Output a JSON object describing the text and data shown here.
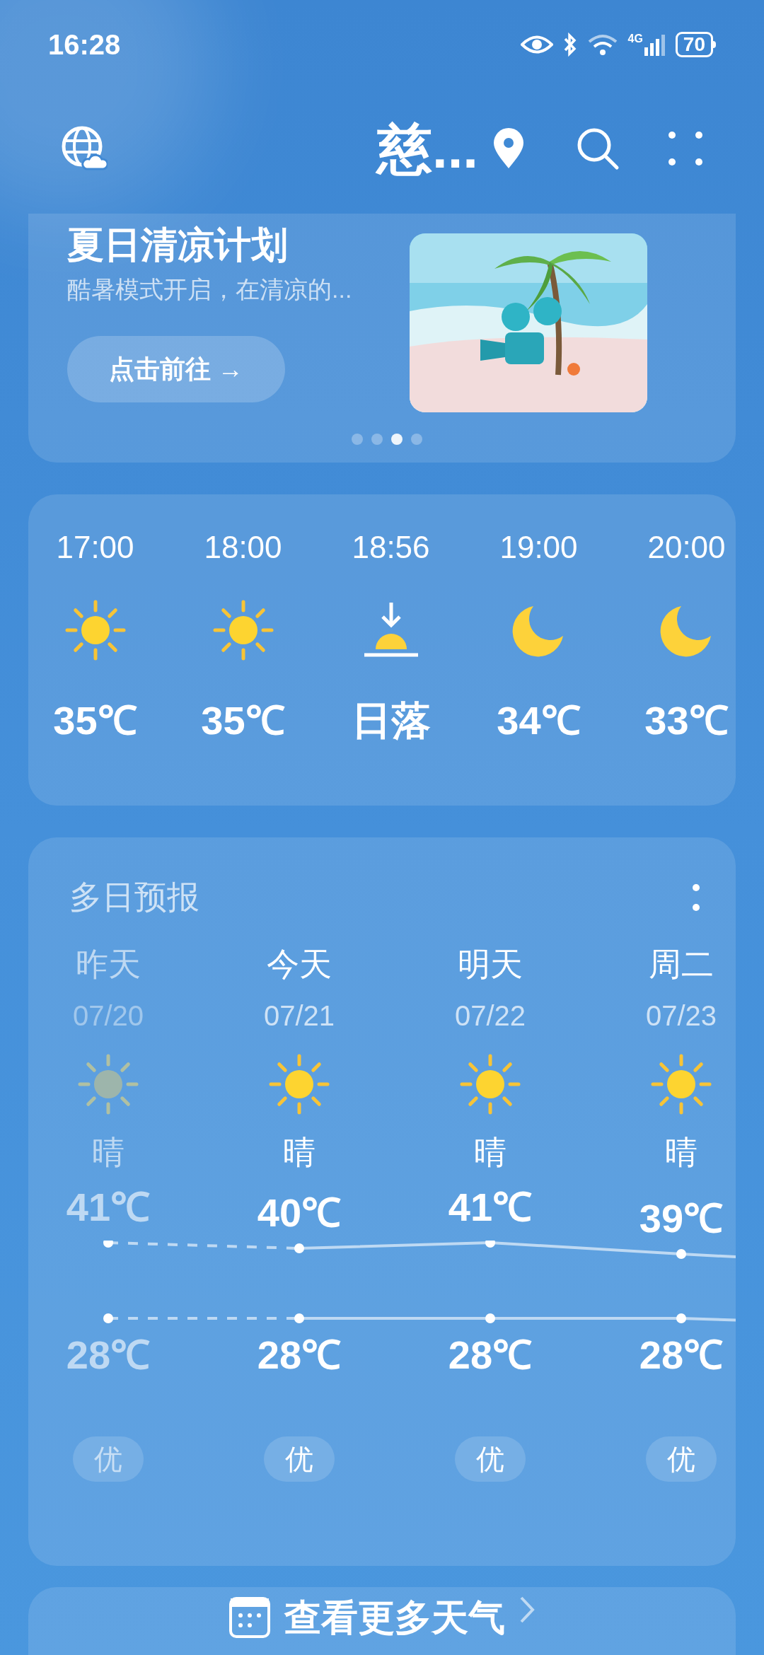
{
  "status_bar": {
    "time": "16:28",
    "network": "4G",
    "battery": "70"
  },
  "header": {
    "city": "慈..."
  },
  "banner": {
    "title": "夏日清凉计划",
    "subtitle": "酷暑模式开启，在清凉的...",
    "button": "点击前往 →",
    "pages": [
      {
        "selected": false
      },
      {
        "selected": false
      },
      {
        "selected": true
      },
      {
        "selected": false
      }
    ]
  },
  "hourly": [
    {
      "time": "17:00",
      "kind": "sun",
      "value": "35℃"
    },
    {
      "time": "18:00",
      "kind": "sun",
      "value": "35℃"
    },
    {
      "time": "18:56",
      "kind": "sunset",
      "value": "日落"
    },
    {
      "time": "19:00",
      "kind": "moon",
      "value": "34℃"
    },
    {
      "time": "20:00",
      "kind": "moon",
      "value": "33℃"
    }
  ],
  "forecast": {
    "title": "多日预报",
    "days": [
      {
        "day": "昨天",
        "date": "07/20",
        "condition": "晴",
        "high": "41℃",
        "low": "28℃",
        "aqi": "优",
        "past": true
      },
      {
        "day": "今天",
        "date": "07/21",
        "condition": "晴",
        "high": "40℃",
        "low": "28℃",
        "aqi": "优",
        "past": false
      },
      {
        "day": "明天",
        "date": "07/22",
        "condition": "晴",
        "high": "41℃",
        "low": "28℃",
        "aqi": "优",
        "past": false
      },
      {
        "day": "周二",
        "date": "07/23",
        "condition": "晴",
        "high": "39℃",
        "low": "28℃",
        "aqi": "优",
        "past": false
      }
    ]
  },
  "more_button": "查看更多天气"
}
